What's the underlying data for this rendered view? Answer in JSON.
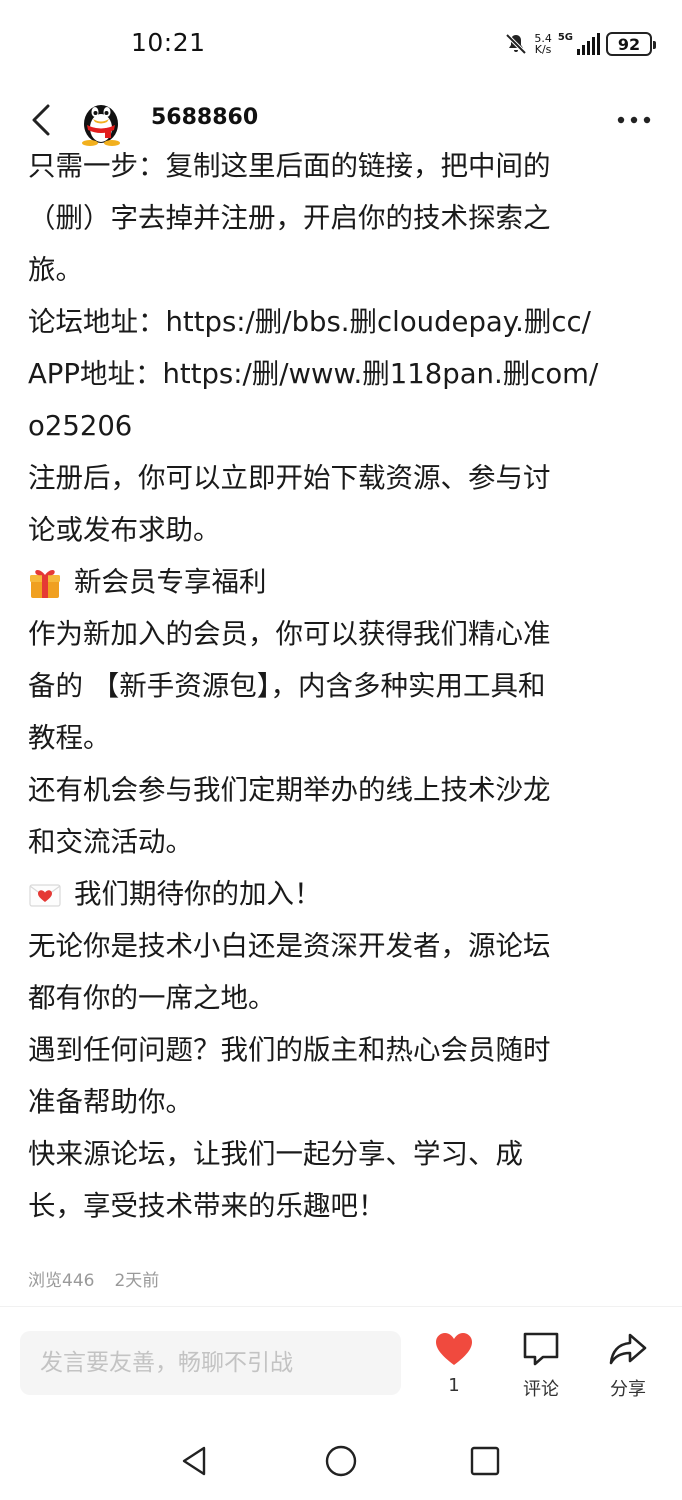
{
  "status_bar": {
    "time": "10:21",
    "net_speed_value": "5.4",
    "net_speed_unit": "K/s",
    "network": "5G",
    "battery": "92"
  },
  "header": {
    "username": "5688860",
    "back_icon": "chevron-left-icon",
    "more_icon": "more-dots-icon"
  },
  "post": {
    "lines": [
      {
        "text": "只需一步：复制这里后面的链接，把中间的"
      },
      {
        "text": "（删）字去掉并注册，开启你的技术探索之"
      },
      {
        "text": "旅。"
      },
      {
        "text": "论坛地址：https:/删/bbs.删cloudepay.删cc/"
      },
      {
        "text": "APP地址：https:/删/www.删118pan.删com/"
      },
      {
        "text": "o25206"
      },
      {
        "text": "注册后，你可以立即开始下载资源、参与讨"
      },
      {
        "text": "论或发布求助。"
      },
      {
        "text": "新会员专享福利",
        "emoji": "gift-icon"
      },
      {
        "text": "作为新加入的会员，你可以获得我们精心准"
      },
      {
        "text": "备的 【新手资源包】，内含多种实用工具和"
      },
      {
        "text": "教程。"
      },
      {
        "text": "还有机会参与我们定期举办的线上技术沙龙"
      },
      {
        "text": "和交流活动。"
      },
      {
        "text": "我们期待你的加入！",
        "emoji": "love-letter-icon"
      },
      {
        "text": "无论你是技术小白还是资深开发者，源论坛"
      },
      {
        "text": "都有你的一席之地。"
      },
      {
        "text": "遇到任何问题？我们的版主和热心会员随时"
      },
      {
        "text": "准备帮助你。"
      },
      {
        "text": "快来源论坛，让我们一起分享、学习、成"
      },
      {
        "text": "长，享受技术带来的乐趣吧！"
      }
    ],
    "views": "浏览446",
    "time_ago": "2天前"
  },
  "bottom_bar": {
    "comment_placeholder": "发言要友善，畅聊不引战",
    "like_count": "1",
    "comment_label": "评论",
    "share_label": "分享",
    "like_color": "#f04a3e"
  },
  "colors": {
    "text": "#1a1a1a",
    "meta": "#9a9a9a",
    "input_bg": "#f5f5f5"
  }
}
